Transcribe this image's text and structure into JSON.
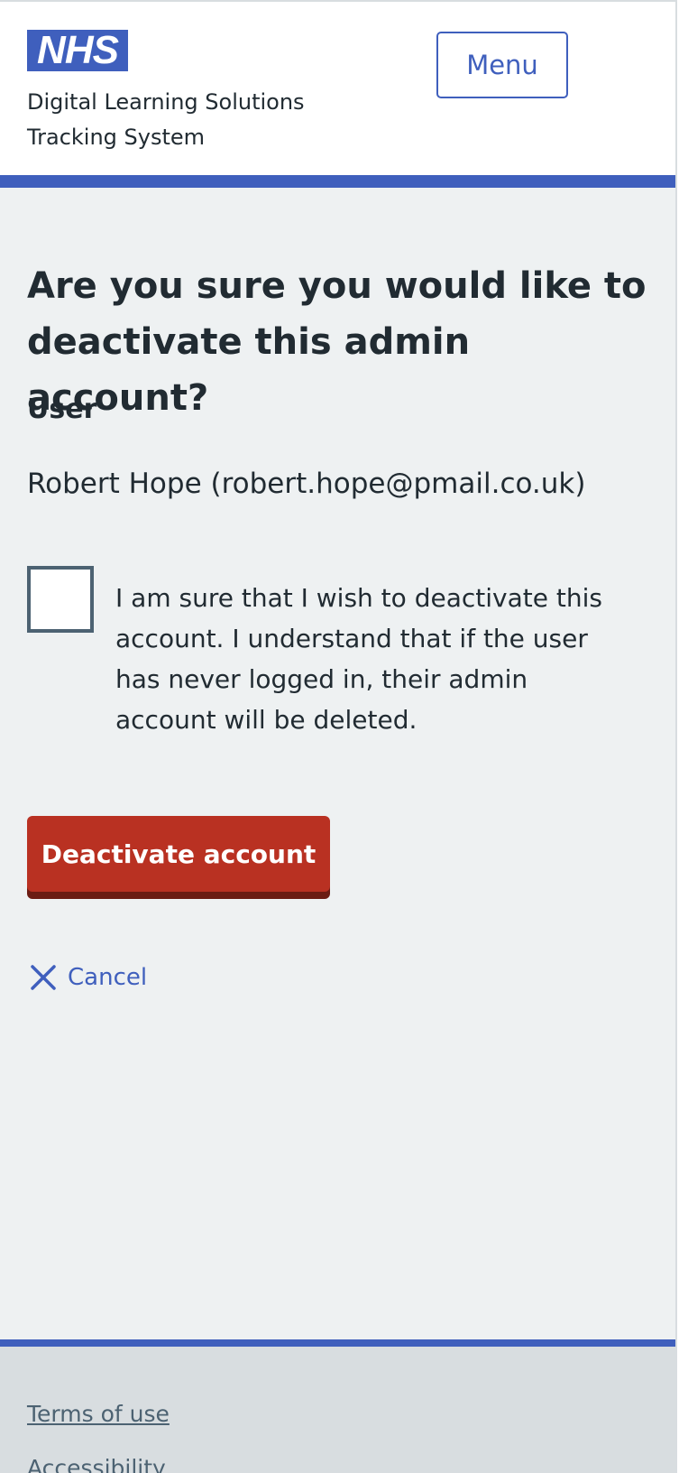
{
  "header": {
    "logo_text": "NHS",
    "service_name": "Digital Learning Solutions Tracking System",
    "menu_label": "Menu",
    "brand_color": "#3f5fbd"
  },
  "main": {
    "title": "Are you sure you would like to deactivate this admin account?",
    "user_label": "User",
    "user_value": "Robert Hope (robert.hope@pmail.co.uk)",
    "confirm_checkbox_checked": false,
    "confirm_text": "I am sure that I wish to deactivate this account. I understand that if the user has never logged in, their admin account will be deleted.",
    "deactivate_button_label": "Deactivate account",
    "deactivate_button_color": "#b93122",
    "cancel_icon": "close-icon",
    "cancel_label": "Cancel"
  },
  "footer": {
    "links": [
      "Terms of use",
      "Accessibility"
    ]
  }
}
